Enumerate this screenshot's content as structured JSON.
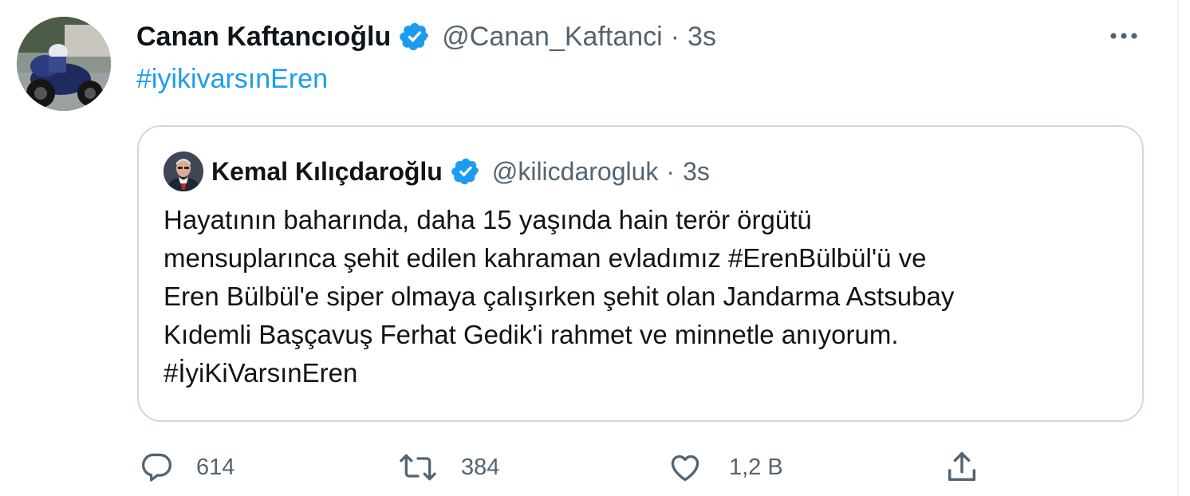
{
  "tweet": {
    "author_name": "Canan Kaftancıoğlu",
    "handle": "@Canan_Kaftanci",
    "separator": "·",
    "time": "3s",
    "text": "#iyikivarsınEren",
    "more_icon": "more-horizontal-icon"
  },
  "quoted": {
    "author_name": "Kemal Kılıçdaroğlu",
    "handle": "@kilicdarogluk",
    "separator": "·",
    "time": "3s",
    "lines": [
      "Hayatının baharında, daha 15 yaşında hain terör örgütü",
      "mensuplarınca şehit edilen kahraman evladımız #ErenBülbül'ü ve",
      "Eren Bülbül'e siper olmaya çalışırken şehit olan Jandarma Astsubay",
      "Kıdemli Başçavuş Ferhat Gedik'i rahmet ve minnetle anıyorum.",
      "#İyiKiVarsınEren"
    ]
  },
  "actions": {
    "reply_count": "614",
    "retweet_count": "384",
    "like_count": "1,2 B"
  },
  "colors": {
    "text": "#0f1419",
    "secondary": "#536471",
    "accent": "#1d9bf0",
    "border": "#cfd9de"
  }
}
